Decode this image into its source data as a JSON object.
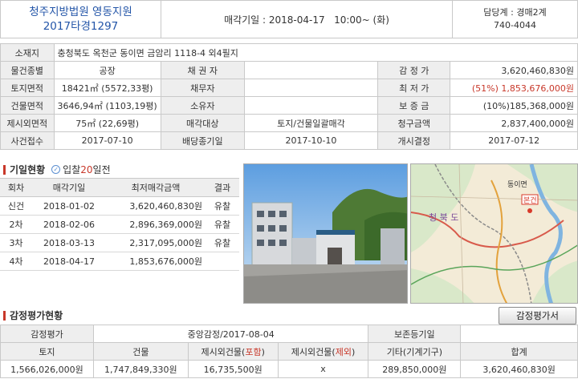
{
  "header": {
    "court_name": "청주지방법원 영동지원",
    "case_number": "2017타경1297",
    "auction_date": "매각기일 : 2018-04-17   10:00~ (화)",
    "dept": "담당계 : 경매2계",
    "phone": "740-4044"
  },
  "info": {
    "location_label": "소재지",
    "location_value": "충청북도 옥천군 동이면 금암리 1118-4 외4필지",
    "type_label": "물건종별",
    "type_value": "공장",
    "creditor_label": "채 권 자",
    "creditor_value": "",
    "appraisal_label": "감 정 가",
    "appraisal_value": "3,620,460,830원",
    "land_area_label": "토지면적",
    "land_area_value": "18421㎡ (5572,33평)",
    "debtor_label": "채무자",
    "debtor_value": "",
    "min_price_label": "최 저 가",
    "min_price_value": "(51%) 1,853,676,000원",
    "bldg_area_label": "건물면적",
    "bldg_area_value": "3646,94㎡ (1103,19평)",
    "owner_label": "소유자",
    "owner_value": "",
    "deposit_label": "보 증 금",
    "deposit_value": "(10%)185,368,000원",
    "excl_area_label": "제시외면적",
    "excl_area_value": "75㎡ (22,69평)",
    "sale_target_label": "매각대상",
    "sale_target_value": "토지/건물일괄매각",
    "claim_label": "청구금액",
    "claim_value": "2,837,400,000원",
    "receipt_label": "사건접수",
    "receipt_value": "2017-07-10",
    "dividend_label": "배당종기일",
    "dividend_value": "2017-10-10",
    "start_label": "개시결정",
    "start_value": "2017-07-12"
  },
  "history": {
    "title": "기일현황",
    "badge_prefix": "입찰",
    "badge_days": "20",
    "badge_suffix": "일전",
    "headers": [
      "회차",
      "매각기일",
      "최저매각금액",
      "결과"
    ],
    "rows": [
      [
        "신건",
        "2018-01-02",
        "3,620,460,830원",
        "유찰"
      ],
      [
        "2차",
        "2018-02-06",
        "2,896,369,000원",
        "유찰"
      ],
      [
        "3차",
        "2018-03-13",
        "2,317,095,000원",
        "유찰"
      ],
      [
        "4차",
        "2018-04-17",
        "1,853,676,000원",
        ""
      ]
    ]
  },
  "appraisal": {
    "title": "감정평가현황",
    "button_label": "감정평가서",
    "row1": {
      "label": "감정평가",
      "firm": "중앙감정/2017-08-04",
      "register_label": "보존등기일",
      "register_value": ""
    },
    "headers": {
      "land": "토지",
      "building": "건물",
      "excl_in_pre": "제시외건물(",
      "excl_in_hl": "포함",
      "excl_out_pre": "제시외건물(",
      "excl_out_hl": "제외",
      "paren": ")",
      "other": "기타(기계기구)",
      "total": "합계"
    },
    "values": {
      "land": "1,566,026,000원",
      "building": "1,747,849,330원",
      "excl_in": "16,735,500원",
      "excl_out": "x",
      "other": "289,850,000원",
      "total": "3,620,460,830원"
    }
  },
  "map": {
    "region_label": "청 북 도",
    "town_label": "동이면",
    "marker_label": "본건"
  },
  "colors": {
    "court_blue": "#2355a8",
    "accent_red": "#c8382a",
    "label_bg": "#eeeeee"
  }
}
